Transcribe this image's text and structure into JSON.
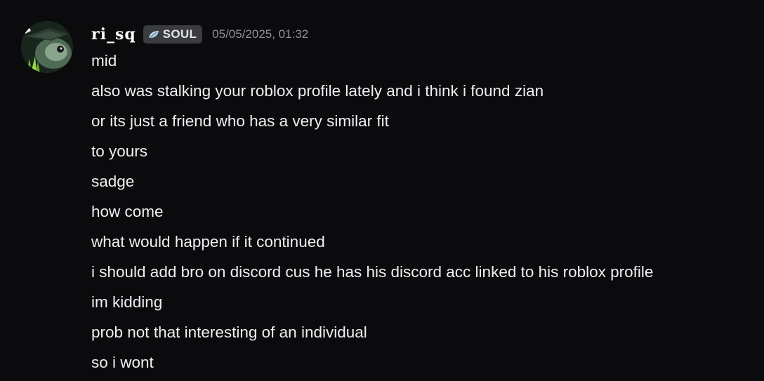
{
  "message": {
    "username": "ri_sq",
    "tag": {
      "label": "SOUL",
      "icon": "leaf-badge-icon"
    },
    "timestamp": "05/05/2025, 01:32",
    "lines": [
      "mid",
      "also was stalking your roblox profile lately and i think i found zian",
      "or its just a friend who has a very similar fit",
      "to yours",
      "sadge",
      "how come",
      "what would happen if it continued",
      "i should add bro on discord cus he has his discord acc linked to his roblox profile",
      "im kidding",
      "prob not that interesting of an individual",
      "so i wont"
    ]
  },
  "colors": {
    "background": "#0b0b0d",
    "text": "#eef0f2",
    "timestamp": "#8e9197",
    "tag_background": "#3a3c42"
  }
}
